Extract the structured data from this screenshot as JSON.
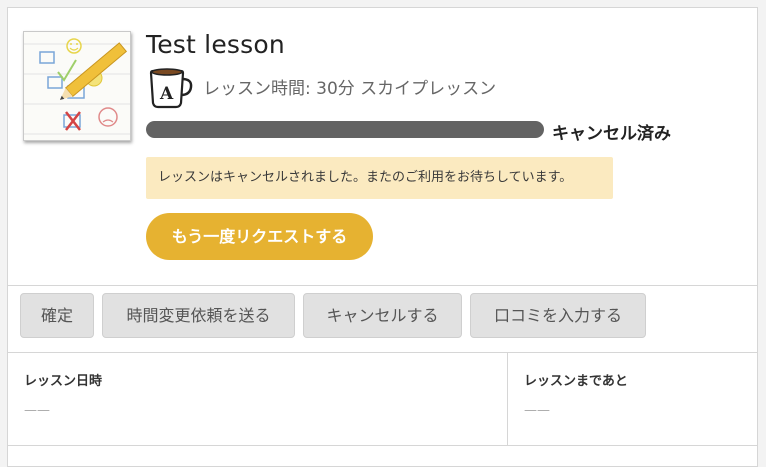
{
  "lesson": {
    "title": "Test lesson",
    "meta": "レッスン時間: 30分 スカイプレッスン",
    "status": "キャンセル済み",
    "notice": "レッスンはキャンセルされました。またのご利用をお待ちしています。",
    "request_again_label": "もう一度リクエストする"
  },
  "progress": {
    "fraction": 1.0,
    "color": "#636363"
  },
  "actions": {
    "confirm": "確定",
    "change_request": "時間変更依頼を送る",
    "cancel": "キャンセルする",
    "review": "口コミを入力する"
  },
  "details": {
    "datetime_label": "レッスン日時",
    "datetime_value": "——",
    "remaining_label": "レッスンまであと",
    "remaining_value": "——"
  },
  "icons": {
    "thumbnail": "checklist-pencil-icon",
    "mug": "coffee-mug-icon"
  },
  "colors": {
    "accent": "#e6b231",
    "notice_bg": "#fbeac0",
    "button_bg": "#e1e1e1"
  }
}
